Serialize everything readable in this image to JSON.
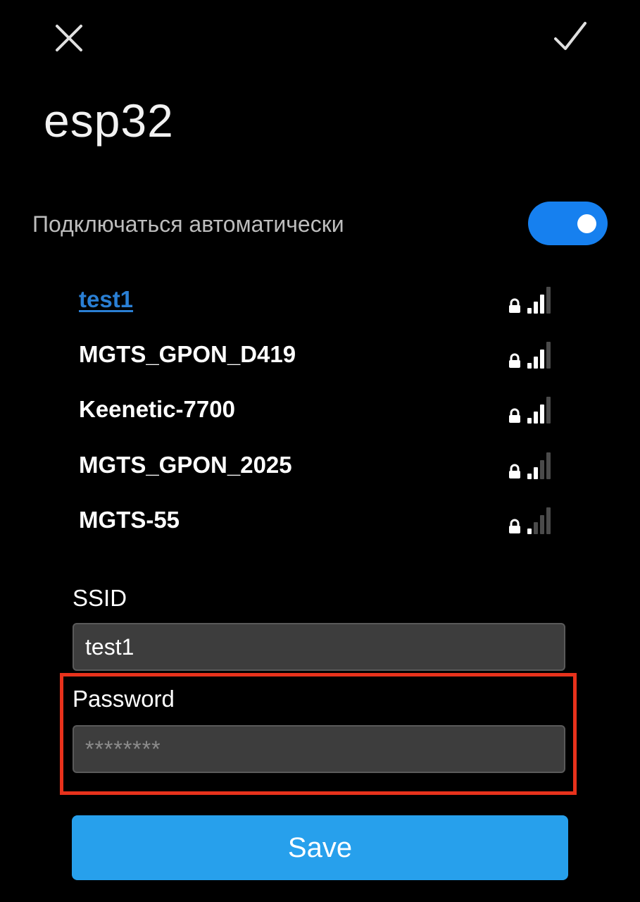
{
  "header": {
    "close_icon": "close-icon",
    "confirm_icon": "checkmark-icon"
  },
  "network": {
    "title": "esp32"
  },
  "auto_connect": {
    "label": "Подключаться автоматически",
    "enabled": true,
    "toggle_color": "#1680ef"
  },
  "wifi_list": [
    {
      "ssid": "test1",
      "selected": true,
      "locked": true,
      "signal_bars": 3,
      "max_bars": 4
    },
    {
      "ssid": "MGTS_GPON_D419",
      "selected": false,
      "locked": true,
      "signal_bars": 3,
      "max_bars": 4
    },
    {
      "ssid": "Keenetic-7700",
      "selected": false,
      "locked": true,
      "signal_bars": 3,
      "max_bars": 4
    },
    {
      "ssid": "MGTS_GPON_2025",
      "selected": false,
      "locked": true,
      "signal_bars": 2,
      "max_bars": 4
    },
    {
      "ssid": "MGTS-55",
      "selected": false,
      "locked": true,
      "signal_bars": 1,
      "max_bars": 4
    }
  ],
  "form": {
    "ssid_label": "SSID",
    "ssid_value": "test1",
    "password_label": "Password",
    "password_placeholder": "********",
    "save_label": "Save"
  },
  "colors": {
    "background": "#000000",
    "selected_link": "#2a7fd4",
    "save_button": "#27a0ec",
    "highlight": "#e8321c",
    "signal_active": "#ffffff",
    "signal_inactive": "#4a4a4a"
  }
}
